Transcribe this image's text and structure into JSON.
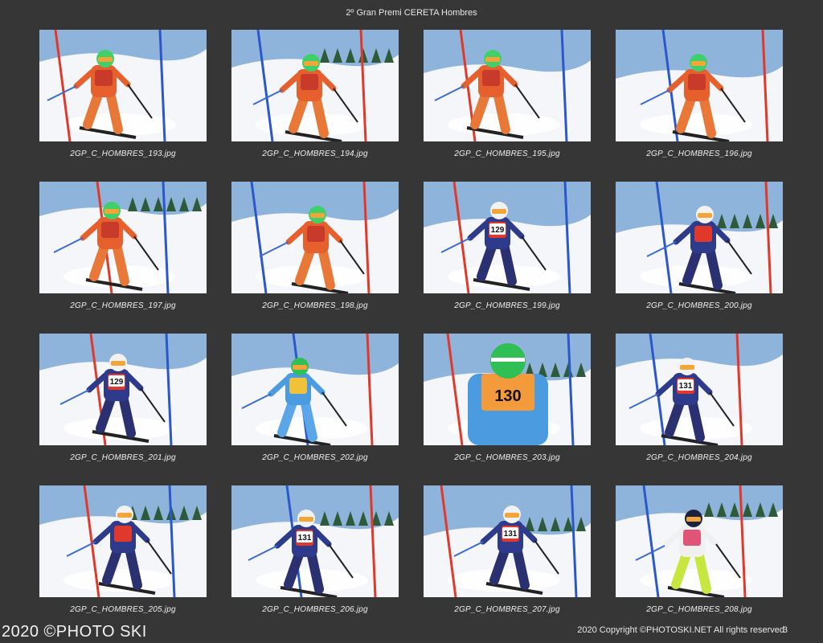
{
  "title": "2º Gran Premi CERETA Hombres",
  "photos": [
    {
      "filename": "2GP_C_HOMBRES_193.jpg",
      "bib": "",
      "suit": "orange"
    },
    {
      "filename": "2GP_C_HOMBRES_194.jpg",
      "bib": "",
      "suit": "orange"
    },
    {
      "filename": "2GP_C_HOMBRES_195.jpg",
      "bib": "",
      "suit": "orange"
    },
    {
      "filename": "2GP_C_HOMBRES_196.jpg",
      "bib": "",
      "suit": "orange"
    },
    {
      "filename": "2GP_C_HOMBRES_197.jpg",
      "bib": "",
      "suit": "orange"
    },
    {
      "filename": "2GP_C_HOMBRES_198.jpg",
      "bib": "",
      "suit": "orange"
    },
    {
      "filename": "2GP_C_HOMBRES_199.jpg",
      "bib": "129",
      "suit": "navy"
    },
    {
      "filename": "2GP_C_HOMBRES_200.jpg",
      "bib": "",
      "suit": "navy"
    },
    {
      "filename": "2GP_C_HOMBRES_201.jpg",
      "bib": "129",
      "suit": "navy"
    },
    {
      "filename": "2GP_C_HOMBRES_202.jpg",
      "bib": "",
      "suit": "lightblue"
    },
    {
      "filename": "2GP_C_HOMBRES_203.jpg",
      "bib": "130",
      "suit": "lightblue"
    },
    {
      "filename": "2GP_C_HOMBRES_204.jpg",
      "bib": "131",
      "suit": "navy"
    },
    {
      "filename": "2GP_C_HOMBRES_205.jpg",
      "bib": "",
      "suit": "navy"
    },
    {
      "filename": "2GP_C_HOMBRES_206.jpg",
      "bib": "131",
      "suit": "navy"
    },
    {
      "filename": "2GP_C_HOMBRES_207.jpg",
      "bib": "131",
      "suit": "navy"
    },
    {
      "filename": "2GP_C_HOMBRES_208.jpg",
      "bib": "",
      "suit": "white"
    }
  ],
  "footer": {
    "left": "2020 ©PHOTO SKI",
    "right": "2020 Copyright ©PHOTOSKI.NET All rights reserved",
    "page": "3"
  },
  "colors": {
    "background": "#363636",
    "snow": "#f4f6f9",
    "sky": "#8fb4dc",
    "gate_red": "#e0392b",
    "gate_blue": "#2a58c8"
  }
}
